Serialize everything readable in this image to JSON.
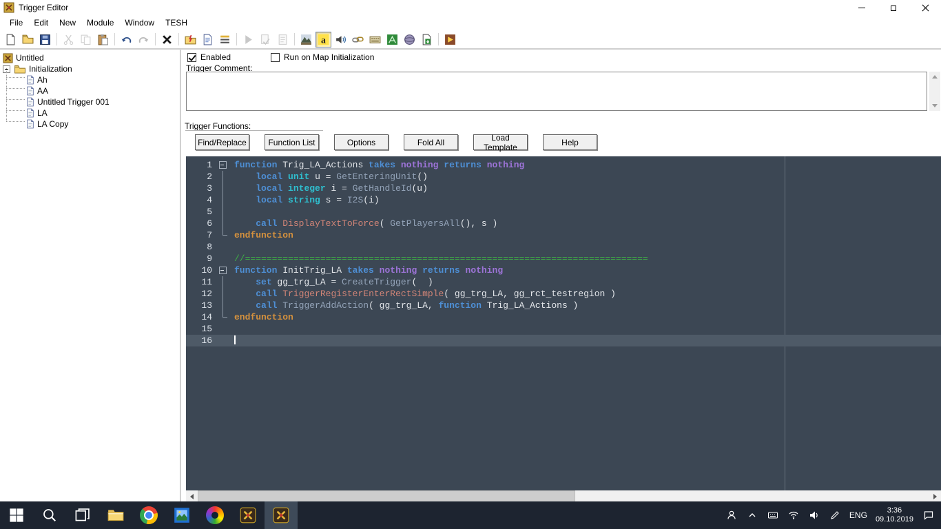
{
  "window": {
    "title": "Trigger Editor"
  },
  "menu": {
    "items": [
      "File",
      "Edit",
      "New",
      "Module",
      "Window",
      "TESH"
    ]
  },
  "toolbar": {
    "icons": [
      {
        "name": "new-map-icon",
        "k": "ic-new"
      },
      {
        "name": "open-map-icon",
        "k": "ic-open"
      },
      {
        "name": "save-map-icon",
        "k": "ic-save"
      },
      {
        "sep": true
      },
      {
        "name": "cut-icon",
        "k": "ic-cut",
        "disabled": true
      },
      {
        "name": "copy-icon",
        "k": "ic-copy",
        "disabled": true
      },
      {
        "name": "paste-icon",
        "k": "ic-paste"
      },
      {
        "sep": true
      },
      {
        "name": "undo-icon",
        "k": "ic-undo"
      },
      {
        "name": "redo-icon",
        "k": "ic-redo",
        "disabled": true
      },
      {
        "sep": true
      },
      {
        "name": "delete-icon",
        "k": "ic-x"
      },
      {
        "sep": true
      },
      {
        "name": "new-category-icon",
        "k": "ic-newcat"
      },
      {
        "name": "new-trigger-icon",
        "k": "ic-newtrig"
      },
      {
        "name": "new-script-icon",
        "k": "ic-newscript"
      },
      {
        "sep": true
      },
      {
        "name": "run-trigger-icon",
        "k": "ic-play",
        "disabled": true
      },
      {
        "name": "check-syntax-icon",
        "k": "ic-check",
        "disabled": true
      },
      {
        "name": "export-script-icon",
        "k": "ic-export",
        "disabled": true
      },
      {
        "sep": true
      },
      {
        "name": "terrain-editor-icon",
        "k": "ic-terrain"
      },
      {
        "name": "trigger-editor-icon",
        "k": "ic-trigedit",
        "active": true
      },
      {
        "name": "sound-editor-icon",
        "k": "ic-sound"
      },
      {
        "name": "object-editor-icon",
        "k": "ic-object"
      },
      {
        "name": "campaign-editor-icon",
        "k": "ic-campaign"
      },
      {
        "name": "ai-editor-icon",
        "k": "ic-ai"
      },
      {
        "name": "object-manager-icon",
        "k": "ic-objmgr"
      },
      {
        "name": "import-manager-icon",
        "k": "ic-import"
      },
      {
        "sep": true
      },
      {
        "name": "test-map-icon",
        "k": "ic-test"
      }
    ]
  },
  "tree": {
    "root": "Untitled",
    "category": "Initialization",
    "items": [
      "Ah",
      "AA",
      "Untitled Trigger 001",
      "LA",
      "LA Copy"
    ]
  },
  "panel": {
    "enabled_label": "Enabled",
    "enabled_checked": true,
    "run_on_init_label": "Run on Map Initialization",
    "run_on_init_checked": false,
    "comment_label": "Trigger Comment:",
    "comment_value": "",
    "functions_label": "Trigger Functions:",
    "buttons": [
      "Find/Replace",
      "Function List",
      "Options",
      "Fold All",
      "Load Template",
      "Help"
    ]
  },
  "editor": {
    "palette": {
      "editor_bg": "#3c4754",
      "current_line_bg": "#4e5a67",
      "keyword": "#4e8fd5",
      "type": "#2fbfcf",
      "nothing_keyword": "#9d74d8",
      "native_function": "#93a3b8",
      "bj_function": "#d28577",
      "endfunction": "#d4913e",
      "comment": "#3fae46",
      "plain_text": "#e2e5e9",
      "line_number": "#dde3ea"
    },
    "lines": [
      {
        "n": "1",
        "fold": "start",
        "tokens": [
          [
            "function",
            "kw"
          ],
          [
            " Trig_LA_Actions ",
            "id"
          ],
          [
            "takes",
            "kw"
          ],
          [
            " ",
            "id"
          ],
          [
            "nothing",
            "pu"
          ],
          [
            " ",
            "id"
          ],
          [
            "returns",
            "kw"
          ],
          [
            " ",
            "id"
          ],
          [
            "nothing",
            "pu"
          ]
        ]
      },
      {
        "n": "2",
        "fold": "mid",
        "tokens": [
          [
            "    ",
            "id"
          ],
          [
            "local",
            "kw"
          ],
          [
            " ",
            "id"
          ],
          [
            "unit",
            "ty"
          ],
          [
            " u = ",
            "id"
          ],
          [
            "GetEnteringUnit",
            "na"
          ],
          [
            "()",
            "id"
          ]
        ]
      },
      {
        "n": "3",
        "fold": "mid",
        "tokens": [
          [
            "    ",
            "id"
          ],
          [
            "local",
            "kw"
          ],
          [
            " ",
            "id"
          ],
          [
            "integer",
            "ty"
          ],
          [
            " i = ",
            "id"
          ],
          [
            "GetHandleId",
            "na"
          ],
          [
            "(u)",
            "id"
          ]
        ]
      },
      {
        "n": "4",
        "fold": "mid",
        "tokens": [
          [
            "    ",
            "id"
          ],
          [
            "local",
            "kw"
          ],
          [
            " ",
            "id"
          ],
          [
            "string",
            "ty"
          ],
          [
            " s = ",
            "id"
          ],
          [
            "I2S",
            "na"
          ],
          [
            "(i)",
            "id"
          ]
        ]
      },
      {
        "n": "5",
        "fold": "mid",
        "tokens": []
      },
      {
        "n": "6",
        "fold": "mid",
        "tokens": [
          [
            "    ",
            "id"
          ],
          [
            "call",
            "kw"
          ],
          [
            " ",
            "id"
          ],
          [
            "DisplayTextToForce",
            "bj"
          ],
          [
            "( ",
            "id"
          ],
          [
            "GetPlayersAll",
            "na"
          ],
          [
            "(), s )",
            "id"
          ]
        ]
      },
      {
        "n": "7",
        "fold": "end",
        "tokens": [
          [
            "endfunction",
            "en"
          ]
        ]
      },
      {
        "n": "8",
        "fold": "",
        "tokens": []
      },
      {
        "n": "9",
        "fold": "",
        "tokens": [
          [
            "//===========================================================================",
            "co"
          ]
        ]
      },
      {
        "n": "10",
        "fold": "start",
        "tokens": [
          [
            "function",
            "kw"
          ],
          [
            " InitTrig_LA ",
            "id"
          ],
          [
            "takes",
            "kw"
          ],
          [
            " ",
            "id"
          ],
          [
            "nothing",
            "pu"
          ],
          [
            " ",
            "id"
          ],
          [
            "returns",
            "kw"
          ],
          [
            " ",
            "id"
          ],
          [
            "nothing",
            "pu"
          ]
        ]
      },
      {
        "n": "11",
        "fold": "mid",
        "tokens": [
          [
            "    ",
            "id"
          ],
          [
            "set",
            "kw"
          ],
          [
            " gg_trg_LA = ",
            "id"
          ],
          [
            "CreateTrigger",
            "na"
          ],
          [
            "(  )",
            "id"
          ]
        ]
      },
      {
        "n": "12",
        "fold": "mid",
        "tokens": [
          [
            "    ",
            "id"
          ],
          [
            "call",
            "kw"
          ],
          [
            " ",
            "id"
          ],
          [
            "TriggerRegisterEnterRectSimple",
            "bj"
          ],
          [
            "( gg_trg_LA, gg_rct_testregion )",
            "id"
          ]
        ]
      },
      {
        "n": "13",
        "fold": "mid",
        "tokens": [
          [
            "    ",
            "id"
          ],
          [
            "call",
            "kw"
          ],
          [
            " ",
            "id"
          ],
          [
            "TriggerAddAction",
            "na"
          ],
          [
            "( gg_trg_LA, ",
            "id"
          ],
          [
            "function",
            "kw"
          ],
          [
            " Trig_LA_Actions )",
            "id"
          ]
        ]
      },
      {
        "n": "14",
        "fold": "end",
        "tokens": [
          [
            "endfunction",
            "en"
          ]
        ]
      },
      {
        "n": "15",
        "fold": "",
        "tokens": []
      },
      {
        "n": "16",
        "fold": "",
        "cur": true,
        "tokens": []
      }
    ]
  },
  "taskbar": {
    "lang": "ENG",
    "time": "3:36",
    "date": "09.10.2019",
    "apps": [
      {
        "name": "start-button",
        "k": "tk-start"
      },
      {
        "name": "search-button",
        "k": "tk-search"
      },
      {
        "name": "task-view-button",
        "k": "tk-taskview"
      },
      {
        "name": "file-explorer-icon",
        "k": "tk-explorer",
        "big": true
      },
      {
        "name": "chrome-icon",
        "k": "tk-chrome"
      },
      {
        "name": "photos-icon",
        "k": "tk-photos",
        "big": true
      },
      {
        "name": "color-app-icon",
        "k": "tk-rainbow"
      },
      {
        "name": "world-editor-icon",
        "k": "tk-we",
        "big": true
      },
      {
        "name": "world-editor-active-icon",
        "k": "tk-we",
        "big": true,
        "active": true
      }
    ],
    "tray": [
      {
        "name": "people-icon",
        "k": "tr-people"
      },
      {
        "name": "hidden-icons-chevron",
        "k": "tr-chev"
      },
      {
        "name": "touch-keyboard-icon",
        "k": "tr-kbd"
      },
      {
        "name": "network-icon",
        "k": "tr-net"
      },
      {
        "name": "volume-icon",
        "k": "tr-vol"
      },
      {
        "name": "pen-icon",
        "k": "tr-pen"
      }
    ]
  }
}
